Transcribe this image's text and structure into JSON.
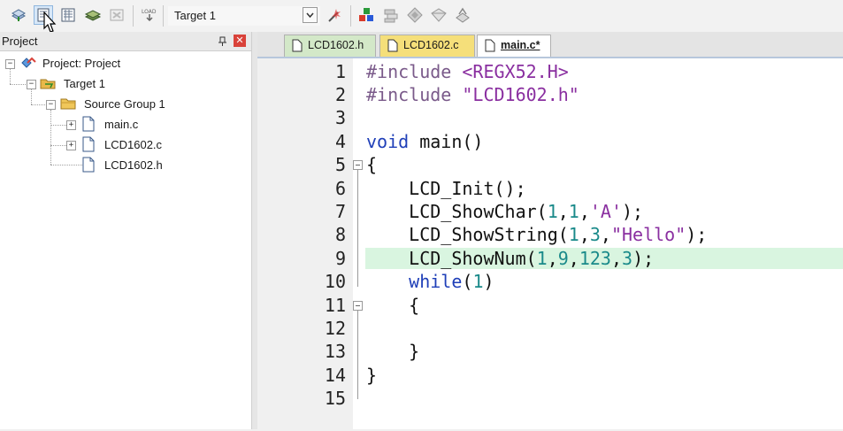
{
  "toolbar": {
    "target_select_value": "Target 1",
    "buttons": [
      "translate-icon",
      "build-icon",
      "rebuild-icon",
      "batch-build-icon",
      "stop-build-icon",
      "download-icon",
      "target-options-icon",
      "manage-components-icon",
      "select-packs-icon",
      "pack-installer-icon",
      "manage-rte-icon",
      "multi-project-icon"
    ]
  },
  "project_panel": {
    "title": "Project",
    "tree": [
      {
        "label": "Project: Project",
        "level": 0
      },
      {
        "label": "Target 1",
        "level": 1
      },
      {
        "label": "Source Group 1",
        "level": 2
      },
      {
        "label": "main.c",
        "level": 3
      },
      {
        "label": "LCD1602.c",
        "level": 3
      },
      {
        "label": "LCD1602.h",
        "level": 3
      }
    ]
  },
  "editor": {
    "tabs": [
      {
        "label": "LCD1602.h",
        "color": "#d3e8c8",
        "active": false
      },
      {
        "label": "LCD1602.c",
        "color": "#f5df7a",
        "active": false
      },
      {
        "label": "main.c*",
        "color": "#ffffff",
        "active": true
      }
    ],
    "line_numbers": [
      "1",
      "2",
      "3",
      "4",
      "5",
      "6",
      "7",
      "8",
      "9",
      "10",
      "11",
      "12",
      "13",
      "14",
      "15"
    ],
    "code": [
      "#include <REGX52.H>",
      "#include \"LCD1602.h\"",
      "",
      "void main()",
      "{",
      "    LCD_Init();",
      "    LCD_ShowChar(1,1,'A');",
      "    LCD_ShowString(1,3,\"Hello\");",
      "    LCD_ShowNum(1,9,123,3);",
      "    while(1)",
      "    {",
      "",
      "    }",
      "}",
      ""
    ],
    "highlighted_line": 9,
    "highlight_color": "#d9f5e0"
  }
}
